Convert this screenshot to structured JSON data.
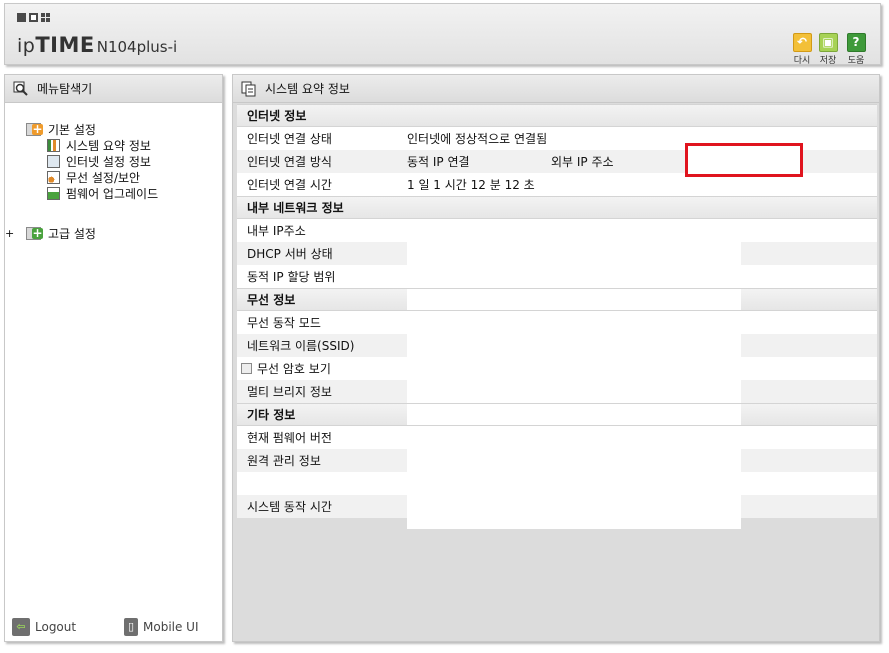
{
  "header": {
    "brand_ip": "ip",
    "brand_time": "TIME",
    "brand_model": "N104plus-i",
    "buttons": {
      "restart": "다시",
      "save": "저장",
      "help": "도움"
    },
    "icons": {
      "restart": "restart-icon",
      "save": "save-icon",
      "help": "help-icon"
    }
  },
  "left_panel": {
    "title": "메뉴탐색기",
    "tree": {
      "basic": {
        "label": "기본 설정",
        "items": [
          "시스템 요약 정보",
          "인터넷 설정 정보",
          "무선 설정/보안",
          "펌웨어 업그레이드"
        ]
      },
      "advanced": {
        "label": "고급 설정"
      }
    },
    "footer": {
      "logout": "Logout",
      "mobile": "Mobile UI"
    }
  },
  "right_panel": {
    "title": "시스템 요약 정보",
    "internet": {
      "heading": "인터넷 정보",
      "conn_state_label": "인터넷 연결 상태",
      "conn_state_value": "인터넷에 정상적으로 연결됨",
      "conn_method_label": "인터넷 연결 방식",
      "conn_method_value": "동적 IP 연결",
      "external_ip_label": "외부 IP 주소",
      "conn_time_label": "인터넷 연결 시간",
      "conn_time_value": "1 일 1 시간 12 분 12 초"
    },
    "lan": {
      "heading": "내부 네트워크 정보",
      "ip_label": "내부 IP주소",
      "dhcp_label": "DHCP 서버 상태",
      "range_label": "동적 IP 할당 범위"
    },
    "wireless": {
      "heading": "무선 정보",
      "mode_label": "무선 동작 모드",
      "ssid_label": "네트워크 이름(SSID)",
      "show_pw_label": "무선 암호 보기",
      "bridge_label": "멀티 브리지 정보"
    },
    "other": {
      "heading": "기타 정보",
      "fw_label": "현재 펌웨어 버전",
      "remote_label": "원격 관리 정보",
      "uptime_label": "시스템 동작 시간"
    }
  },
  "colors": {
    "highlight_box": "#e0141e",
    "panel_gray": "#dcdcdc"
  }
}
